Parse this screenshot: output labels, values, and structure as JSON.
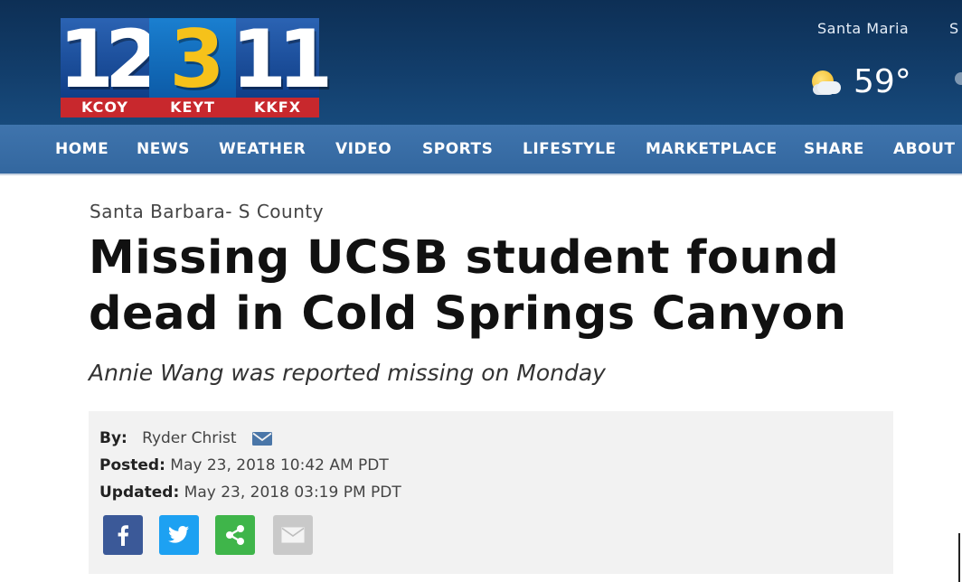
{
  "header": {
    "logo": {
      "numbers": [
        "12",
        "3",
        "11"
      ],
      "callsigns": [
        "KCOY",
        "KEYT",
        "KKFX"
      ]
    },
    "weather": {
      "city": "Santa Maria",
      "next_city_partial": "S",
      "temperature": "59°",
      "icon": "partly-sunny-icon"
    }
  },
  "nav": {
    "items": [
      "HOME",
      "NEWS",
      "WEATHER",
      "VIDEO",
      "SPORTS",
      "LIFESTYLE",
      "MARKETPLACE",
      "SHARE",
      "ABOUT"
    ]
  },
  "article": {
    "section": "Santa Barbara- S County",
    "headline_line1": "Missing UCSB student found",
    "headline_line2": "dead in Cold Springs Canyon",
    "subhead": "Annie Wang was reported missing on Monday",
    "byline": {
      "by_label": "By:",
      "author": "Ryder Christ",
      "posted_label": "Posted:",
      "posted": "May 23, 2018 10:42 AM PDT",
      "updated_label": "Updated:",
      "updated": "May 23, 2018 03:19 PM PDT"
    },
    "share_buttons": [
      "facebook-icon",
      "twitter-icon",
      "share-icon",
      "email-icon"
    ]
  },
  "colors": {
    "header_bg": "#123d6a",
    "nav_bg": "#3a6ea7",
    "facebook": "#3b5998",
    "twitter": "#1da1f2",
    "share": "#3fb54a",
    "email": "#c9c9c9",
    "logo_accent": "#f6c21a",
    "callsign_bar": "#c8282d"
  }
}
